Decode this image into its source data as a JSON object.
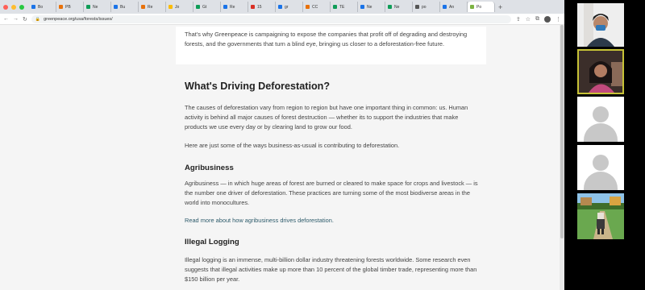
{
  "browser": {
    "tabs": [
      {
        "label": "Bo",
        "color": "#1a73e8"
      },
      {
        "label": "PB",
        "color": "#e8710a"
      },
      {
        "label": "Ne",
        "color": "#0f9d58"
      },
      {
        "label": "Bu",
        "color": "#1a73e8"
      },
      {
        "label": "Re",
        "color": "#e8710a"
      },
      {
        "label": "Jo",
        "color": "#fbbc04"
      },
      {
        "label": "Gt",
        "color": "#0f9d58"
      },
      {
        "label": "Re",
        "color": "#1a73e8"
      },
      {
        "label": "15",
        "color": "#d93025"
      },
      {
        "label": "gr",
        "color": "#1a73e8"
      },
      {
        "label": "CC",
        "color": "#e8710a"
      },
      {
        "label": "TE",
        "color": "#0f9d58"
      },
      {
        "label": "Ne",
        "color": "#1a73e8"
      },
      {
        "label": "Ne",
        "color": "#0f9d58"
      },
      {
        "label": "po",
        "color": "#555555"
      },
      {
        "label": "An",
        "color": "#1a73e8"
      },
      {
        "label": "Po",
        "color": "#7cb342",
        "active": true
      }
    ],
    "url": "greenpeace.org/usa/forests/issues/"
  },
  "article": {
    "intro_text": "That's why Greenpeace is campaigning to expose the companies that profit off of degrading and destroying forests, and the governments that turn a blind eye, bringing us closer to a deforestation-free future.",
    "heading": "What's Driving Deforestation?",
    "causes_text": "The causes of deforestation vary from region to region but have one important thing in common: us. Human activity is behind all major causes of forest destruction — whether its to support the industries that make products we use every day or by clearing land to grow our food.",
    "ways_text": "Here are just some of the ways business-as-usual is contributing to deforestation.",
    "agri_heading": "Agribusiness",
    "agri_text": "Agribusiness — in which huge areas of forest are burned or cleared to make space for crops and livestock — is the number one driver of deforestation. These practices are turning some of the most biodiverse areas in the world into monocultures.",
    "agri_link": "Read more about how agribusiness drives deforestation.",
    "logging_heading": "Illegal Logging",
    "logging_text": "Illegal logging is an immense, multi-billion dollar industry threatening forests worldwide. Some research even suggests that illegal activities make up more than 10 percent of the global timber trade, representing more than $150 billion per year."
  },
  "video_gallery": {
    "participants": [
      {
        "type": "camera"
      },
      {
        "type": "camera",
        "active_speaker": true
      },
      {
        "type": "avatar-placeholder"
      },
      {
        "type": "avatar-placeholder"
      },
      {
        "type": "camera"
      }
    ]
  },
  "colors": {
    "active_speaker_border": "#c7c337",
    "link": "#2d5b6b",
    "page_background": "#f5f5f5"
  }
}
